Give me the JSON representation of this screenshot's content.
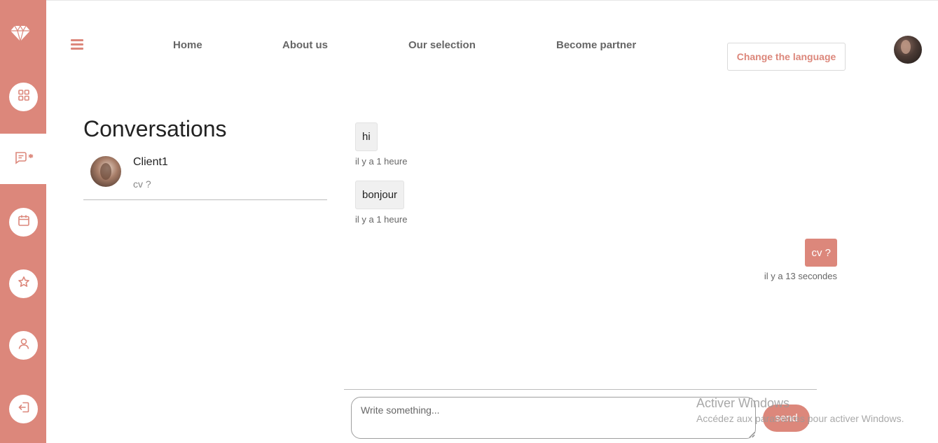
{
  "sidebar": {
    "accent": "#dc877b",
    "logo_icon": "diamond-icon",
    "items": [
      {
        "icon": "grid-icon",
        "active": false
      },
      {
        "icon": "message-edit-icon",
        "active": true
      },
      {
        "icon": "calendar-icon",
        "active": false
      },
      {
        "icon": "star-icon",
        "active": false
      },
      {
        "icon": "user-icon",
        "active": false
      },
      {
        "icon": "logout-icon",
        "active": false
      }
    ]
  },
  "header": {
    "menu_icon": "hamburger-icon",
    "nav": [
      "Home",
      "About us",
      "Our selection",
      "Become partner"
    ],
    "language_button": "Change the language"
  },
  "conversations": {
    "title": "Conversations",
    "items": [
      {
        "name": "Client1",
        "preview": "cv ?"
      }
    ]
  },
  "chat": {
    "messages": [
      {
        "text": "hi",
        "time": "il y a 1 heure",
        "from": "other"
      },
      {
        "text": "bonjour",
        "time": "il y a 1 heure",
        "from": "other"
      },
      {
        "text": "cv ?",
        "time": "il y a 13 secondes",
        "from": "me"
      }
    ],
    "input_placeholder": "Write something...",
    "send_label": "send"
  },
  "watermark": {
    "title": "Activer Windows",
    "subtitle": "Accédez aux paramètres pour activer Windows."
  }
}
